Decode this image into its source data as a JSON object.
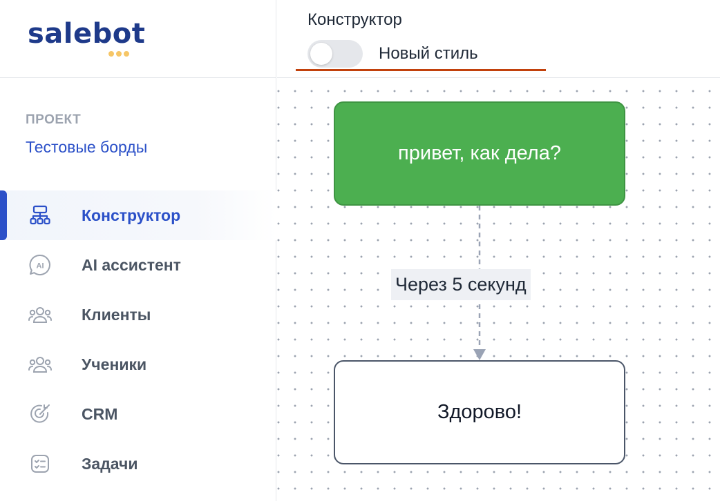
{
  "logo": {
    "text": "salebot",
    "dot_color": "#f6c667",
    "text_color": "#1e3a8a"
  },
  "project": {
    "label": "ПРОЕКТ",
    "name": "Тестовые борды"
  },
  "nav": {
    "items": [
      {
        "label": "Конструктор",
        "icon": "sitemap-icon",
        "active": true
      },
      {
        "label": "AI ассистент",
        "icon": "ai-chat-icon",
        "active": false
      },
      {
        "label": "Клиенты",
        "icon": "users-icon",
        "active": false
      },
      {
        "label": "Ученики",
        "icon": "students-icon",
        "active": false
      },
      {
        "label": "CRM",
        "icon": "target-icon",
        "active": false
      },
      {
        "label": "Задачи",
        "icon": "checklist-icon",
        "active": false
      }
    ]
  },
  "header": {
    "title": "Конструктор",
    "toggle_label": "Новый стиль",
    "toggle_on": false,
    "underline_color": "#c2410c"
  },
  "canvas": {
    "blocks": [
      {
        "text": "привет, как дела?",
        "color": "#4caf50"
      },
      {
        "text": "Здорово!",
        "color": "#ffffff"
      }
    ],
    "connector_label": "Через 5 секунд"
  },
  "colors": {
    "accent": "#2b50c8",
    "muted": "#9ca3af"
  }
}
